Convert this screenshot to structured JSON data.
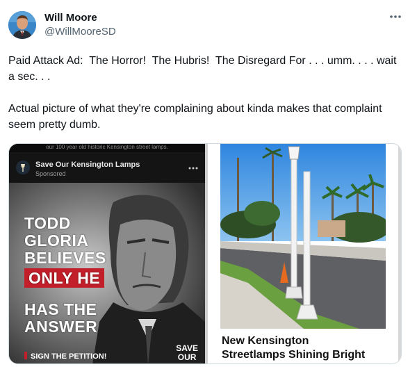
{
  "author": {
    "name": "Will Moore",
    "handle": "@WillMooreSD"
  },
  "tweet": {
    "text": "Paid Attack Ad:  The Horror!  The Hubris!  The Disregard For . . . umm. . . . wait a sec. . .\n\nActual picture of what they're complaining about kinda makes that complaint seem pretty dumb."
  },
  "ad": {
    "top_banner": "our 100 year old historic Kensington street lamps.",
    "page_name": "Save Our Kensington Lamps",
    "sponsored_label": "Sponsored",
    "headline_lines": [
      "TODD",
      "GLORIA",
      "BELIEVES"
    ],
    "highlight_line": "ONLY HE",
    "closing_lines": [
      "HAS THE",
      "ANSWER"
    ],
    "cta": "SIGN THE PETITION!",
    "brand_lines": [
      "SAVE",
      "OUR"
    ]
  },
  "photo": {
    "caption_line1": "New Kensington",
    "caption_line2": "Streetlamps Shining Bright"
  },
  "icons": {
    "more": "more-horizontal-icon"
  },
  "colors": {
    "accent_red": "#c31f2b",
    "handle_gray": "#536471",
    "sky_blue": "#2e88e0"
  }
}
